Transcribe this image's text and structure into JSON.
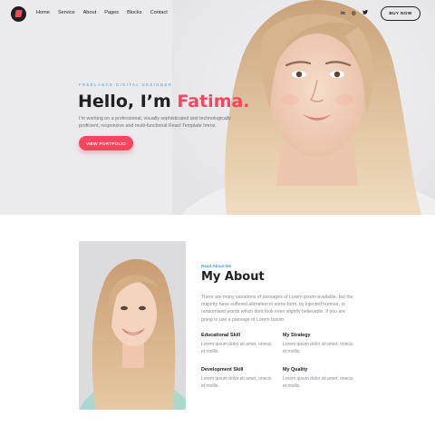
{
  "colors": {
    "accent": "#f4465f",
    "eyebrow": "#4d9ad6",
    "dark": "#1f1f25",
    "hero_bg": "#ebebed"
  },
  "nav": {
    "logo_icon": "logo-icon",
    "items": [
      {
        "label": "Home"
      },
      {
        "label": "Service"
      },
      {
        "label": "About"
      },
      {
        "label": "Pages"
      },
      {
        "label": "Blocks"
      },
      {
        "label": "Contact"
      }
    ],
    "social": [
      {
        "icon": "linkedin-icon",
        "glyph": "in"
      },
      {
        "icon": "instagram-icon",
        "glyph": "◎"
      },
      {
        "icon": "twitter-icon",
        "glyph": "🐦"
      }
    ],
    "buy_label": "BUY NOW"
  },
  "hero": {
    "eyebrow": "FREELANCE DIGITAL DESIGNER",
    "greeting": "Hello, I’m ",
    "name": "Fatima.",
    "description": "I’m working on a professional, visually sophisticated and technologically proficient, responsive and multi-functional React Template Imroz.",
    "cta_label": "VIEW PORTFOLIO"
  },
  "about": {
    "label": "Read About Me",
    "title": "My About",
    "text": "There are many variations of passages of Lorem ipsum available, but the majority have suffered alteration in some form, by injected humour, or randomised words which dont look even slightly believable. If you are going to use a passage of Lorem Ipsum.",
    "skills": [
      {
        "title": "Educational Skill",
        "desc": "Lorem ipsum dolor sit amet, onecis et mollis."
      },
      {
        "title": "My Strategy",
        "desc": "Lorem ipsum dolor sit amet, onecis et mollis."
      },
      {
        "title": "Development Skill",
        "desc": "Lorem ipsum dolor sit amet, onecis et mollis."
      },
      {
        "title": "My Quality",
        "desc": "Lorem ipsum dolor sit amet, onecis et mollis."
      }
    ]
  }
}
